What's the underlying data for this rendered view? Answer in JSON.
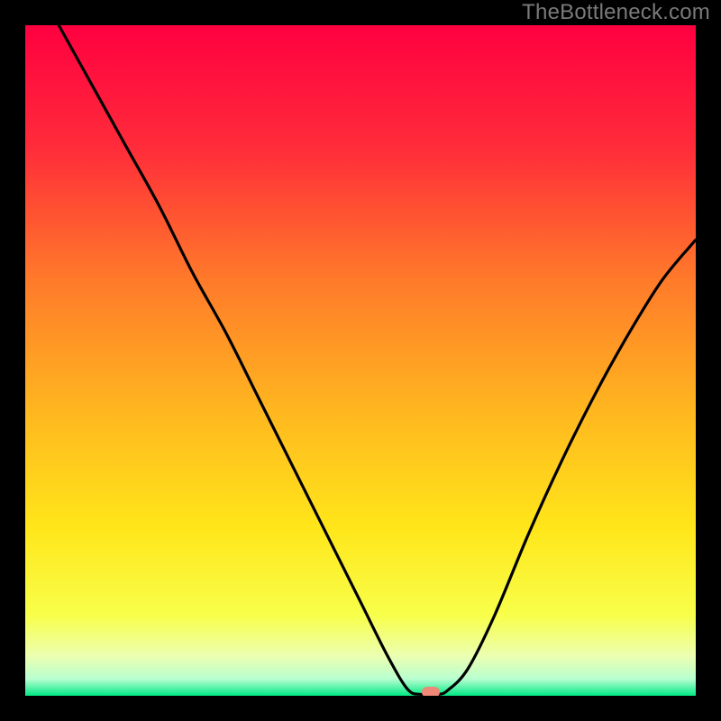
{
  "watermark": "TheBottleneck.com",
  "colors": {
    "frame_bg": "#000000",
    "curve": "#000000",
    "watermark": "#7a7a7a",
    "marker": "#f08878",
    "gradient_stops": [
      {
        "offset": 0.0,
        "color": "#ff0040"
      },
      {
        "offset": 0.18,
        "color": "#ff2b3a"
      },
      {
        "offset": 0.38,
        "color": "#ff7a2a"
      },
      {
        "offset": 0.58,
        "color": "#ffb81f"
      },
      {
        "offset": 0.75,
        "color": "#ffe61a"
      },
      {
        "offset": 0.88,
        "color": "#f8ff4a"
      },
      {
        "offset": 0.94,
        "color": "#ecffb0"
      },
      {
        "offset": 0.975,
        "color": "#b8ffd0"
      },
      {
        "offset": 1.0,
        "color": "#00e985"
      }
    ]
  },
  "chart_data": {
    "type": "line",
    "title": "",
    "xlabel": "",
    "ylabel": "",
    "xlim": [
      0,
      100
    ],
    "ylim": [
      0,
      100
    ],
    "curve_points": [
      {
        "x": 5,
        "y": 100
      },
      {
        "x": 10,
        "y": 91
      },
      {
        "x": 15,
        "y": 82
      },
      {
        "x": 20,
        "y": 73
      },
      {
        "x": 25,
        "y": 63
      },
      {
        "x": 30,
        "y": 54
      },
      {
        "x": 35,
        "y": 44
      },
      {
        "x": 40,
        "y": 34
      },
      {
        "x": 45,
        "y": 24
      },
      {
        "x": 50,
        "y": 14
      },
      {
        "x": 54,
        "y": 6
      },
      {
        "x": 57,
        "y": 1
      },
      {
        "x": 59,
        "y": 0.2
      },
      {
        "x": 61.5,
        "y": 0.2
      },
      {
        "x": 63,
        "y": 0.8
      },
      {
        "x": 66,
        "y": 4
      },
      {
        "x": 70,
        "y": 12
      },
      {
        "x": 75,
        "y": 24
      },
      {
        "x": 80,
        "y": 35
      },
      {
        "x": 85,
        "y": 45
      },
      {
        "x": 90,
        "y": 54
      },
      {
        "x": 95,
        "y": 62
      },
      {
        "x": 100,
        "y": 68
      }
    ],
    "marker": {
      "x": 60.5,
      "y": 0.5
    },
    "annotations": []
  }
}
